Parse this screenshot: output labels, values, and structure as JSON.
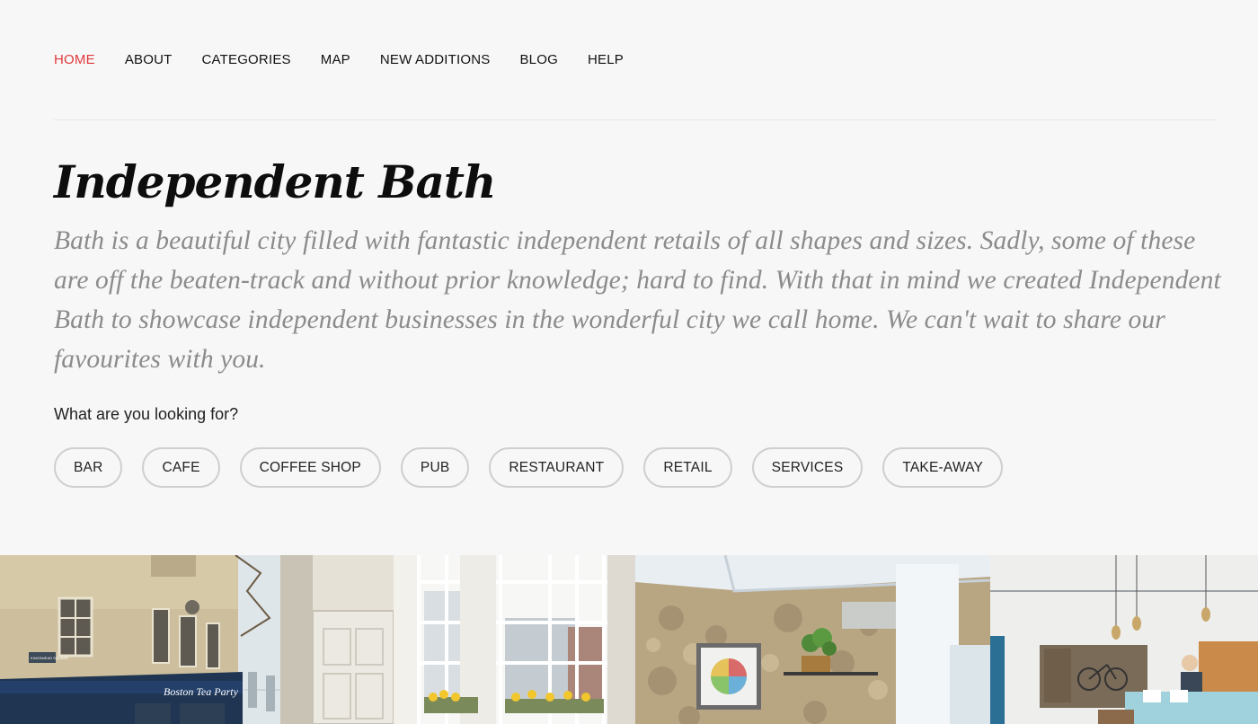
{
  "nav": {
    "items": [
      {
        "label": "HOME",
        "active": true
      },
      {
        "label": "ABOUT",
        "active": false
      },
      {
        "label": "CATEGORIES",
        "active": false
      },
      {
        "label": "MAP",
        "active": false
      },
      {
        "label": "NEW ADDITIONS",
        "active": false
      },
      {
        "label": "BLOG",
        "active": false
      },
      {
        "label": "HELP",
        "active": false
      }
    ]
  },
  "hero": {
    "title": "Independent Bath",
    "intro": "Bath is a beautiful city filled with fantastic independent retails of all shapes and sizes. Sadly, some of these are off the beaten-track and without prior knowledge; hard to find. With that in mind we created Independent Bath to showcase independent businesses in the wonderful city we call home. We can't wait to share our favourites with you."
  },
  "search": {
    "question": "What are you looking for?",
    "tags": [
      "BAR",
      "CAFE",
      "COFFEE SHOP",
      "PUB",
      "RESTAURANT",
      "RETAIL",
      "SERVICES",
      "TAKE-AWAY"
    ]
  },
  "photos": {
    "storefront_sign": "Boston Tea Party",
    "street_sign": "KINGSMEAD SQUARE"
  },
  "colors": {
    "accent": "#e0393e",
    "text": "#111111",
    "muted": "#8b8b8b",
    "background": "#f7f7f7"
  }
}
